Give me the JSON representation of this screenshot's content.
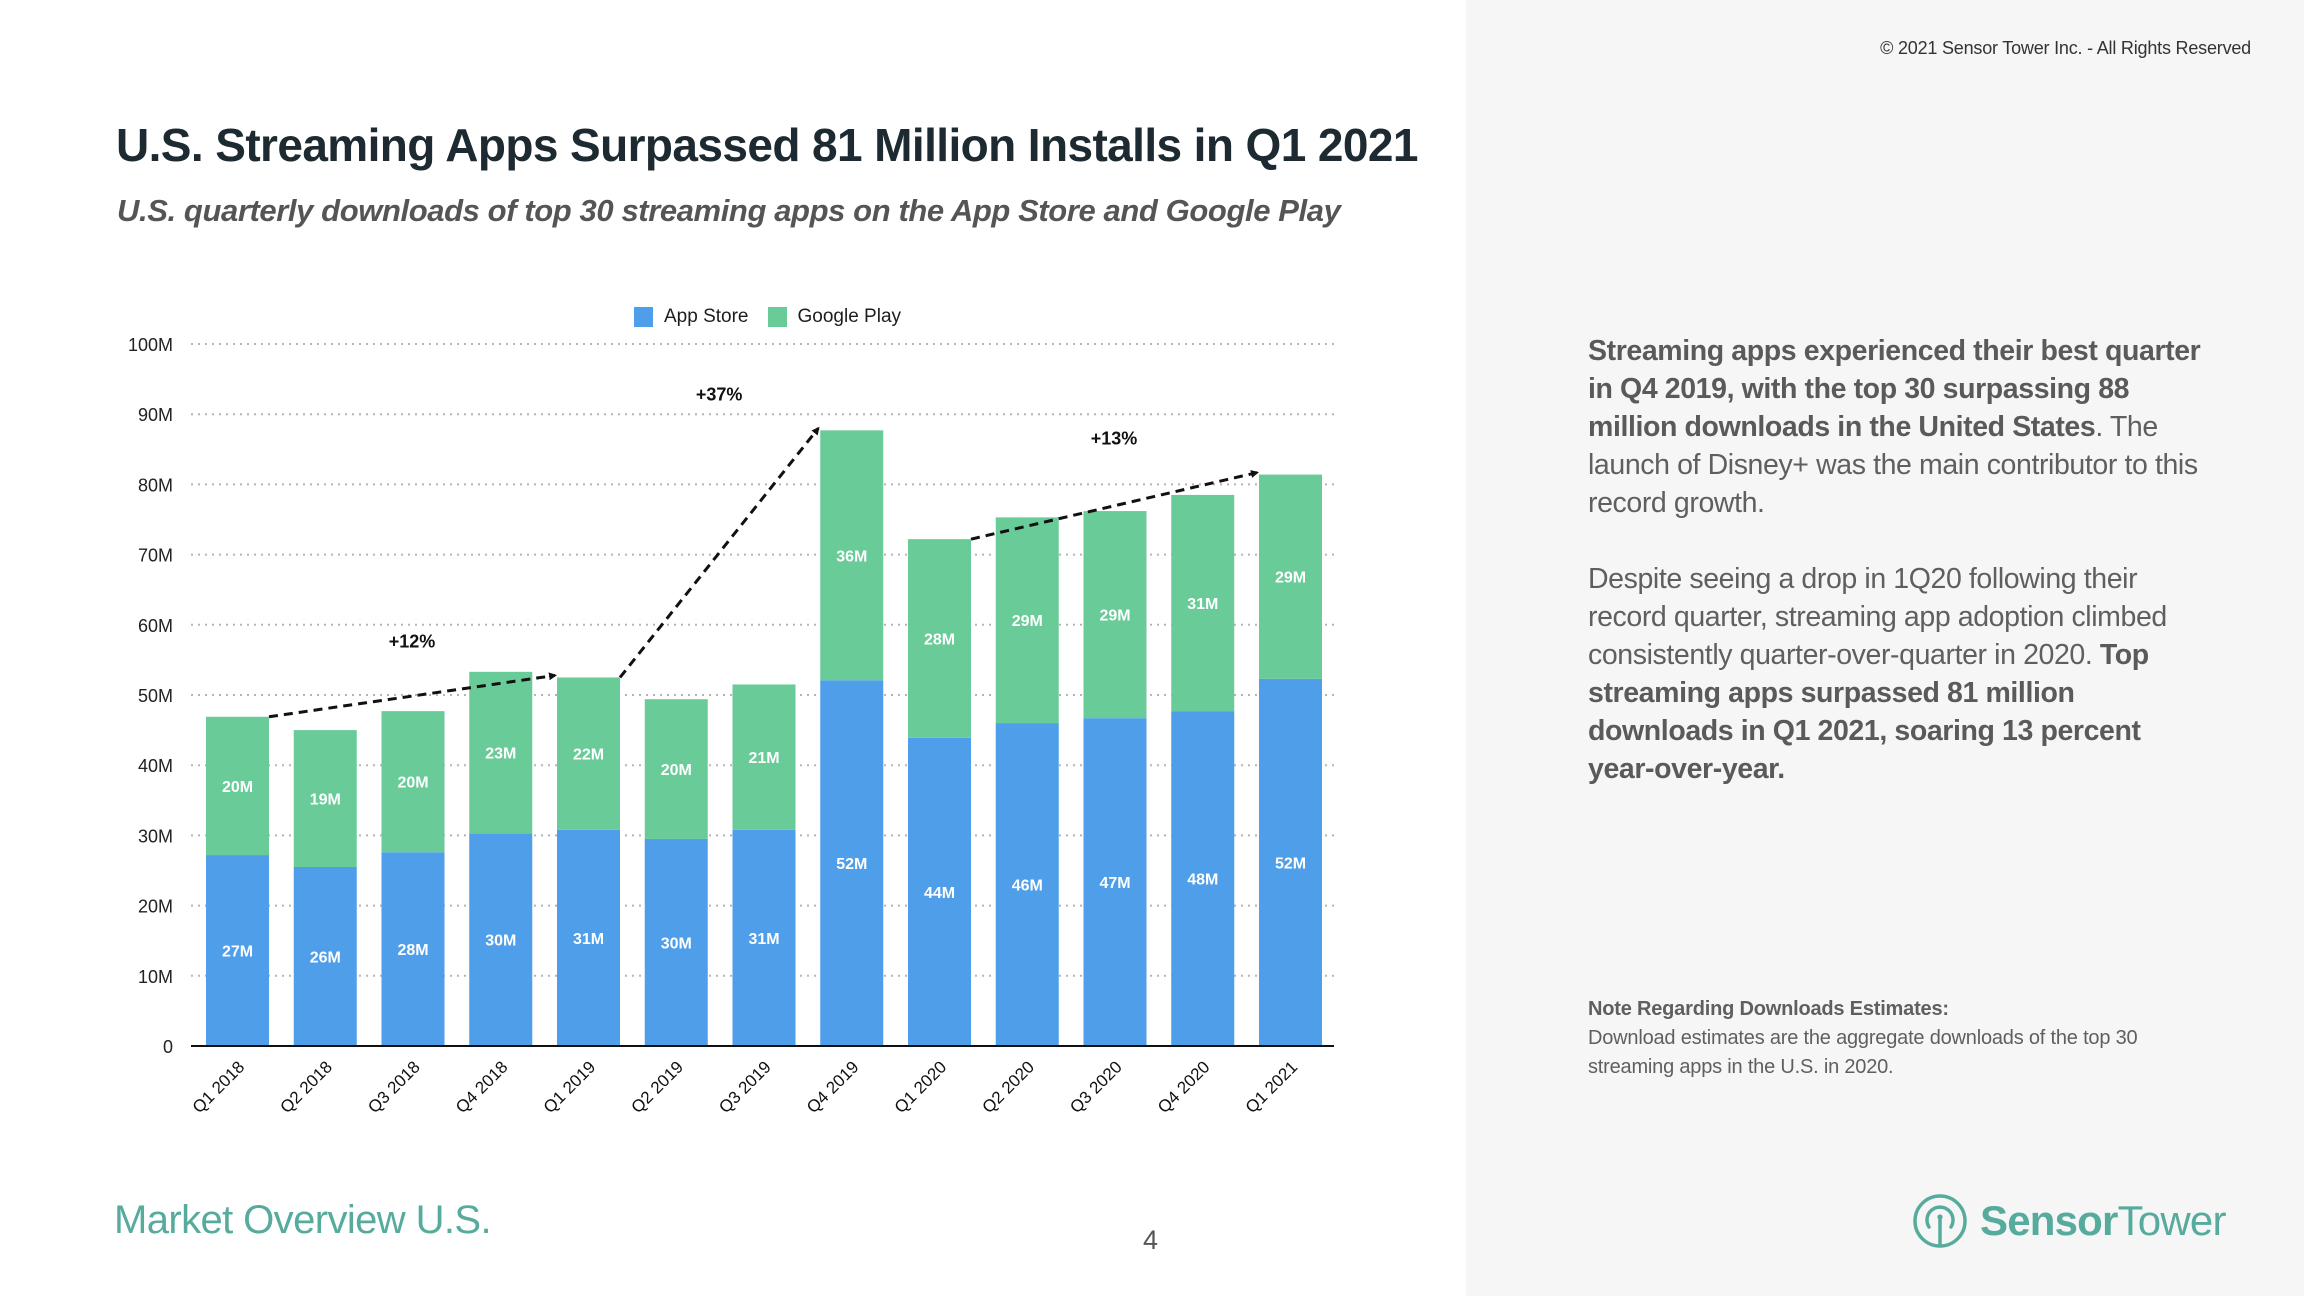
{
  "header": {
    "copyright": "© 2021 Sensor Tower Inc. - All Rights Reserved",
    "title": "U.S. Streaming Apps Surpassed 81 Million Installs in Q1 2021",
    "subtitle": "U.S. quarterly downloads of top 30 streaming apps on the App Store and Google Play"
  },
  "colors": {
    "app_store": "#4e9ee9",
    "google_play": "#69cb98",
    "brand": "#56ab9d"
  },
  "chart_data": {
    "type": "bar",
    "stacked": true,
    "title": "",
    "xlabel": "",
    "ylabel": "",
    "ylim": [
      0,
      100
    ],
    "yticks": [
      0,
      10,
      20,
      30,
      40,
      50,
      60,
      70,
      80,
      90,
      100
    ],
    "ytick_labels": [
      "0",
      "10M",
      "20M",
      "30M",
      "40M",
      "50M",
      "60M",
      "70M",
      "80M",
      "90M",
      "100M"
    ],
    "grid": true,
    "legend_position": "top-center",
    "categories": [
      "Q1 2018",
      "Q2 2018",
      "Q3 2018",
      "Q4 2018",
      "Q1 2019",
      "Q2 2019",
      "Q3 2019",
      "Q4 2019",
      "Q1 2020",
      "Q2 2020",
      "Q3 2020",
      "Q4 2020",
      "Q1 2021"
    ],
    "series": [
      {
        "name": "App Store",
        "color": "#4e9ee9",
        "values": [
          27.2,
          25.5,
          27.6,
          30.3,
          30.8,
          29.5,
          30.8,
          52.1,
          43.9,
          46.0,
          46.7,
          47.7,
          52.3
        ],
        "labels": [
          "27M",
          "26M",
          "28M",
          "30M",
          "31M",
          "30M",
          "31M",
          "52M",
          "44M",
          "46M",
          "47M",
          "48M",
          "52M"
        ]
      },
      {
        "name": "Google Play",
        "color": "#69cb98",
        "values": [
          19.7,
          19.5,
          20.1,
          23.0,
          21.7,
          19.9,
          20.7,
          35.6,
          28.3,
          29.3,
          29.5,
          30.8,
          29.1
        ],
        "labels": [
          "20M",
          "19M",
          "20M",
          "23M",
          "22M",
          "20M",
          "21M",
          "36M",
          "28M",
          "29M",
          "29M",
          "31M",
          "29M"
        ]
      }
    ],
    "annotations": [
      {
        "text": "+12%",
        "from": "Q1 2018",
        "to": "Q1 2019"
      },
      {
        "text": "+37%",
        "from": "Q1 2019",
        "to": "Q4 2019"
      },
      {
        "text": "+13%",
        "from": "Q1 2020",
        "to": "Q1 2021"
      }
    ]
  },
  "commentary": {
    "p1_bold": "Streaming apps experienced their best quarter in Q4 2019, with the top 30 surpassing 88 million downloads in the United States",
    "p1_rest": ". The launch of Disney+ was the main contributor to this record growth.",
    "p2_regular": "Despite seeing a drop in 1Q20 following their record quarter, streaming app adoption climbed consistently quarter-over-quarter in 2020. ",
    "p2_bold": "Top streaming apps surpassed 81 million downloads in Q1 2021, soaring 13 percent year-over-year."
  },
  "note": {
    "heading": "Note Regarding Downloads Estimates:",
    "body": "Download estimates are the aggregate downloads of the top 30 streaming apps in the U.S. in 2020."
  },
  "footer": {
    "section": "Market Overview U.S.",
    "page_number": "4",
    "logo_bold": "Sensor",
    "logo_light": "Tower"
  }
}
